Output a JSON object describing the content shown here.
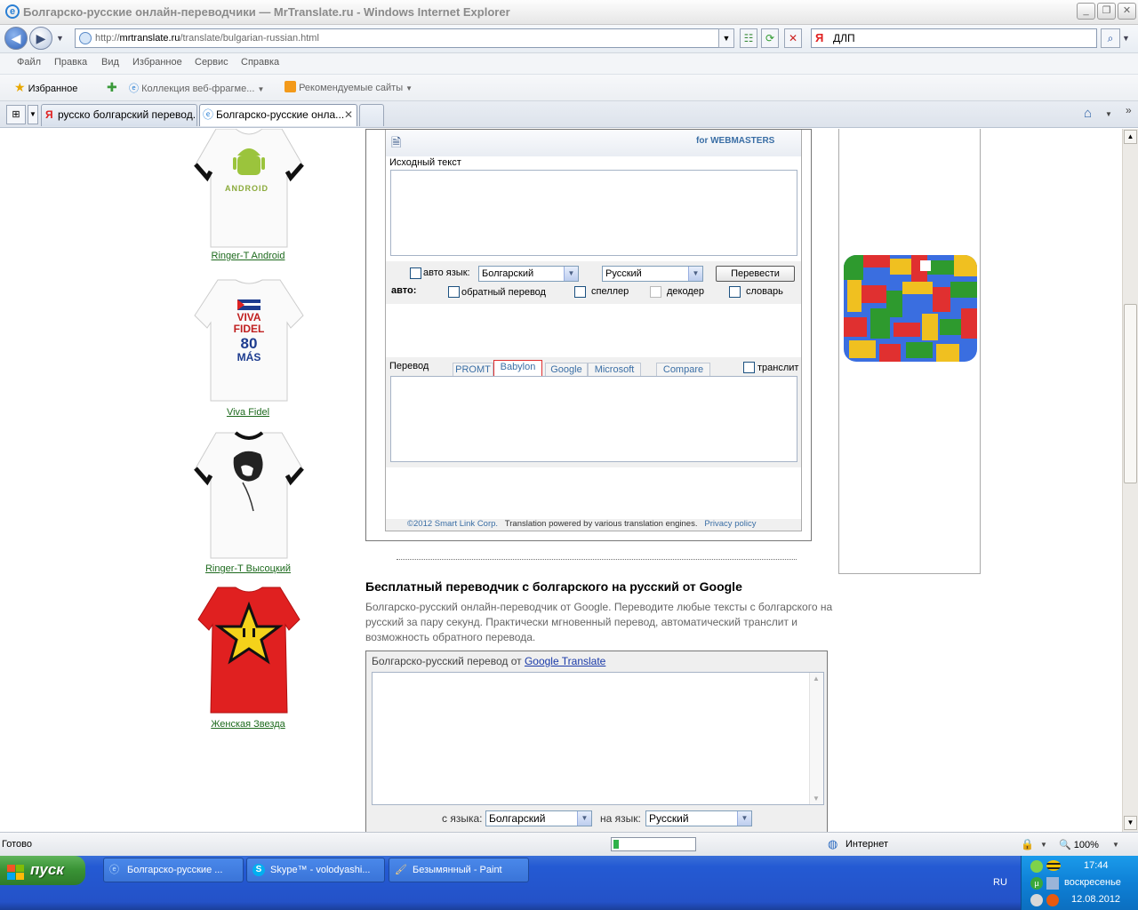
{
  "window": {
    "title": "Болгарско-русские онлайн-переводчики — MrTranslate.ru - Windows Internet Explorer"
  },
  "address": {
    "prefix": "http://",
    "host": "mrtranslate.ru",
    "path": "/translate/bulgarian-russian.html"
  },
  "search": {
    "value": "ДЛП"
  },
  "menu": [
    "Файл",
    "Правка",
    "Вид",
    "Избранное",
    "Сервис",
    "Справка"
  ],
  "favorites": {
    "label": "Избранное",
    "gallery": "Коллекция веб-фрагме...",
    "suggested": "Рекомендуемые сайты"
  },
  "tabs": [
    {
      "label": "русско болгарский перевод..."
    },
    {
      "label": "Болгарско-русские онла..."
    }
  ],
  "shirts": [
    {
      "caption": "Ringer-T Android",
      "print": "ANDROID"
    },
    {
      "caption": "Viva Fidel",
      "print_lines": [
        "VIVA",
        "FIDEL",
        "80",
        "MÁS"
      ]
    },
    {
      "caption": "Ringer-T Высоцкий"
    },
    {
      "caption": "Женская Звезда"
    }
  ],
  "translator": {
    "webmasters": "for WEBMASTERS",
    "source_label": "Исходный текст",
    "auto_lang": "авто язык:",
    "from_lang": "Болгарский",
    "to_lang": "Русский",
    "translate_btn": "Перевести",
    "auto_label": "авто:",
    "opt_reverse": "обратный перевод",
    "opt_speller": "спеллер",
    "opt_decoder": "декодер",
    "opt_dictionary": "словарь",
    "result_label": "Перевод",
    "engines": [
      "PROMT",
      "Babylon",
      "Google",
      "Microsoft",
      "Compare"
    ],
    "active_engine": "Babylon",
    "translit": "транслит",
    "footer_copy": "©2012 Smart Link Corp.",
    "footer_powered": "Translation powered by various translation engines.",
    "footer_privacy": "Privacy policy"
  },
  "google": {
    "title": "Бесплатный переводчик с болгарского на русский от Google",
    "description": "Болгарско-русский онлайн-переводчик от Google. Переводите любые тексты с болгарского на русский за пару секунд. Практически мгновенный перевод, автоматический транслит и возможность обратного перевода.",
    "box_prefix": "Болгарско-русский перевод от",
    "box_link": "Google Translate",
    "from_label": "с языка:",
    "from_value": "Болгарский",
    "to_label": "на язык:",
    "to_value": "Русский"
  },
  "status": {
    "text": "Готово",
    "zone": "Интернет",
    "zoom": "100%"
  },
  "taskbar": {
    "start": "пуск",
    "buttons": [
      {
        "label": "Болгарско-русские ..."
      },
      {
        "label": "Skype™ - volodyashi..."
      },
      {
        "label": "Безымянный - Paint"
      }
    ],
    "lang": "RU",
    "time": "17:44",
    "day": "воскресенье",
    "date": "12.08.2012"
  }
}
